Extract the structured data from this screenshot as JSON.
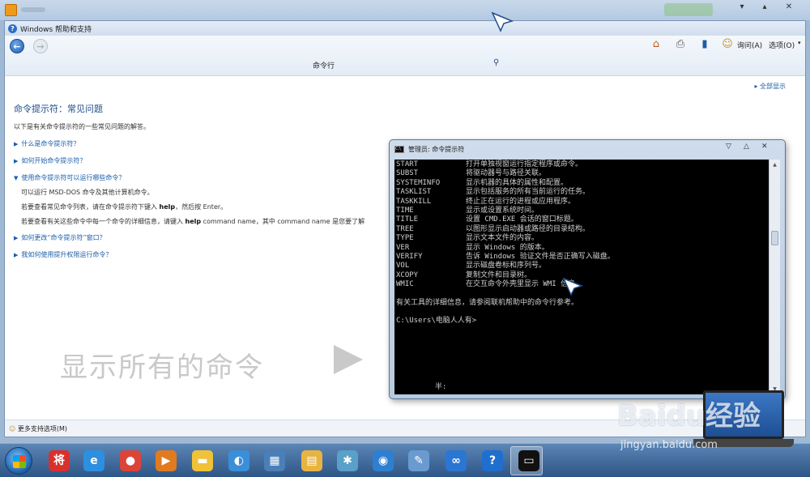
{
  "help_window": {
    "title": "Windows 帮助和支持",
    "search_label": "命令行",
    "toolbar": {
      "ask_label": "询问(A)",
      "options_label": "选项(O)"
    },
    "show_all": "全部显示",
    "page_title": "命令提示符：常见问题",
    "intro": "以下是有关命令提示符的一些常见问题的解答。",
    "questions": [
      {
        "label": "什么是命令提示符？"
      },
      {
        "label": "如何开始命令提示符？"
      },
      {
        "label": "使用命令提示符可以运行哪些命令？"
      },
      {
        "label": "如何更改“命令提示符”窗口？"
      },
      {
        "label": "我如何使用提升权限运行命令？"
      }
    ],
    "answer_lines": {
      "a1": "可以运行 MSD-DOS 命令及其他计算机命令。",
      "a2_pre": "若要查看常见命令列表，请在命令提示符下键入 ",
      "a2_bold": "help",
      "a2_post": "，然后按 Enter。",
      "a3_pre": "若要查看有关这些命令中每一个命令的详细信息，请键入 ",
      "a3_bold": "help",
      "a3_post": " command name，其中 command name 是您要了解"
    },
    "watermark": "显示所有的命令",
    "status": "更多支持选项(M)"
  },
  "cmd_window": {
    "title": "管理员: 命令提示符",
    "rows": [
      {
        "cmd": "START",
        "desc": "打开单独视窗运行指定程序或命令。"
      },
      {
        "cmd": "SUBST",
        "desc": "将驱动器号与路径关联。"
      },
      {
        "cmd": "SYSTEMINFO",
        "desc": "显示机器的具体的属性和配置。"
      },
      {
        "cmd": "TASKLIST",
        "desc": "显示包括服务的所有当前运行的任务。"
      },
      {
        "cmd": "TASKKILL",
        "desc": "终止正在运行的进程或应用程序。"
      },
      {
        "cmd": "TIME",
        "desc": "显示或设置系统时间。"
      },
      {
        "cmd": "TITLE",
        "desc": "设置 CMD.EXE 会话的窗口标题。"
      },
      {
        "cmd": "TREE",
        "desc": "以图形显示启动器或路径的目录结构。"
      },
      {
        "cmd": "TYPE",
        "desc": "显示文本文件的内容。"
      },
      {
        "cmd": "VER",
        "desc": "显示 Windows 的版本。"
      },
      {
        "cmd": "VERIFY",
        "desc": "告诉 Windows 验证文件是否正确写入磁盘。"
      },
      {
        "cmd": "VOL",
        "desc": "显示磁盘卷标和序列号。"
      },
      {
        "cmd": "XCOPY",
        "desc": "复制文件和目录树。"
      },
      {
        "cmd": "WMIC",
        "desc": "在交互命令外壳里显示 WMI 信息。"
      }
    ],
    "footer": "有关工具的详细信息，请参阅联机帮助中的命令行参考。",
    "prompt": "C:\\Users\\电脑人人有>",
    "ime": "半:"
  },
  "baidu": {
    "text": "Baidu经验",
    "url": "jingyan.baidu.com"
  },
  "taskbar": {
    "apps": [
      {
        "name": "antivirus-app",
        "glyph": "将",
        "color": "#d9302c"
      },
      {
        "name": "ie-app",
        "glyph": "e",
        "color": "#2d8fe0"
      },
      {
        "name": "chrome-app",
        "glyph": "●",
        "color": "#db4437"
      },
      {
        "name": "media-app",
        "glyph": "▶",
        "color": "#e07b1f"
      },
      {
        "name": "folder-app",
        "glyph": "▬",
        "color": "#f0c23a"
      },
      {
        "name": "browser-app",
        "glyph": "◐",
        "color": "#3a8fd8"
      },
      {
        "name": "control-app",
        "glyph": "▦",
        "color": "#4a7fb8"
      },
      {
        "name": "explorer-app",
        "glyph": "▤",
        "color": "#e8b440"
      },
      {
        "name": "network-app",
        "glyph": "✱",
        "color": "#5aa0c8"
      },
      {
        "name": "sync-app",
        "glyph": "◉",
        "color": "#2f7fd0"
      },
      {
        "name": "paint-app",
        "glyph": "✎",
        "color": "#6a9bd0"
      },
      {
        "name": "cloud-app",
        "glyph": "∞",
        "color": "#2a76d2"
      },
      {
        "name": "help-app",
        "glyph": "?",
        "color": "#1f6fcf"
      },
      {
        "name": "cmd-app",
        "glyph": "▭",
        "color": "#111111"
      }
    ]
  }
}
